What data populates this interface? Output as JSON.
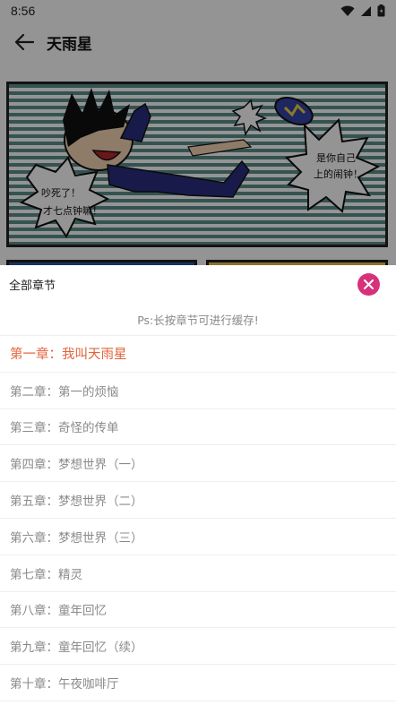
{
  "status_bar": {
    "time": "8:56",
    "icons": [
      "wifi-icon",
      "signal-icon",
      "battery-icon"
    ]
  },
  "app_bar": {
    "back_icon": "arrow-left-icon",
    "title": "天雨星"
  },
  "comic": {
    "bubble_left_line1": "吵死了！",
    "bubble_left_line2": "才七点钟嘛！",
    "bubble_right_line1": "是你自己",
    "bubble_right_line2": "上的闹钟！"
  },
  "chapter_sheet": {
    "title": "全部章节",
    "close_icon": "close-icon",
    "hint": "Ps:长按章节可进行缓存!",
    "active_color": "#e2633a",
    "accent_color": "#d6317a",
    "chapters": [
      {
        "label": "第一章：我叫天雨星",
        "active": true
      },
      {
        "label": "第二章：第一的烦恼",
        "active": false
      },
      {
        "label": "第三章：奇怪的传单",
        "active": false
      },
      {
        "label": "第四章：梦想世界（一）",
        "active": false
      },
      {
        "label": "第五章：梦想世界（二）",
        "active": false
      },
      {
        "label": "第六章：梦想世界（三）",
        "active": false
      },
      {
        "label": "第七章：精灵",
        "active": false
      },
      {
        "label": "第八章：童年回忆",
        "active": false
      },
      {
        "label": "第九章：童年回忆（续）",
        "active": false
      },
      {
        "label": "第十章：午夜咖啡厅",
        "active": false
      }
    ]
  }
}
